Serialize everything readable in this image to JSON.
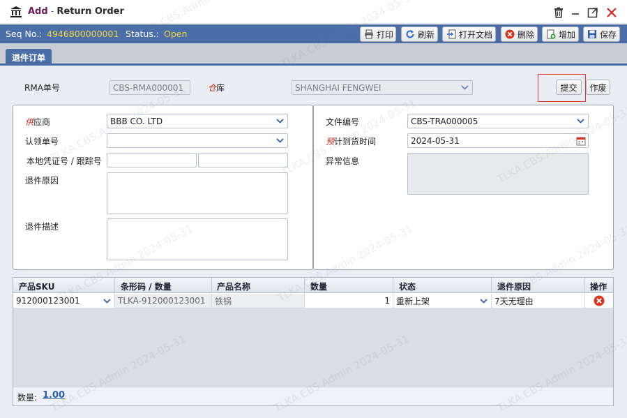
{
  "window": {
    "title_add": "Add",
    "title_sep": "-",
    "title_name": "Return Order",
    "icons": [
      "bank-icon",
      "trash-icon",
      "minimize-icon",
      "maximize-icon",
      "close-icon"
    ]
  },
  "seq": {
    "seq_label": "Seq No.:",
    "seq_value": "4946800000001",
    "status_label": "Status.:",
    "status_value": "Open"
  },
  "toolbar": {
    "print": "打印",
    "refresh": "刷新",
    "open_doc": "打开文档",
    "delete": "删除",
    "add": "增加",
    "save": "保存"
  },
  "tabs": [
    {
      "label": "退件订单"
    }
  ],
  "header": {
    "rma_label": "RMA单号",
    "rma_value": "CBS-RMA000001",
    "warehouse_req": "仓",
    "warehouse_label": "库",
    "warehouse_value": "SHANGHAI FENGWEI",
    "submit": "提交",
    "void": "作废"
  },
  "left": {
    "supplier_req": "供",
    "supplier_label": "应商",
    "supplier_value": "BBB CO. LTD",
    "claim_label": "认领单号",
    "claim_value": "",
    "voucher_label": "本地凭证号 / 跟踪号",
    "voucher_value_1": "",
    "voucher_value_2": "",
    "reason_label": "退件原因",
    "reason_value": "",
    "desc_label": "退件描述",
    "desc_value": ""
  },
  "right": {
    "file_label": "文件编号",
    "file_value": "CBS-TRA000005",
    "eta_req": "预",
    "eta_label": "计到货时间",
    "eta_value": "2024-05-31",
    "exception_label": "异常信息",
    "exception_value": ""
  },
  "grid": {
    "columns": [
      "产品SKU",
      "条形码 / 数量",
      "产品名称",
      "数量",
      "状态",
      "退件原因",
      "操作"
    ],
    "rows": [
      {
        "sku": "912000123001",
        "barcode": "TLKA-912000123001",
        "name": "铁锅",
        "qty": "1",
        "status": "重新上架",
        "reason": "7天无理由"
      }
    ],
    "footer_label": "数量:",
    "footer_value": "1.00"
  },
  "watermark": "TLKA.CBS.Admin 2024-05-31",
  "colors": {
    "accent": "#4a6fa8",
    "seq_value": "#f2d63c",
    "required": "#cc2a1a",
    "add_text": "#6b1a5b",
    "highlight_box": "#e03a2f"
  }
}
